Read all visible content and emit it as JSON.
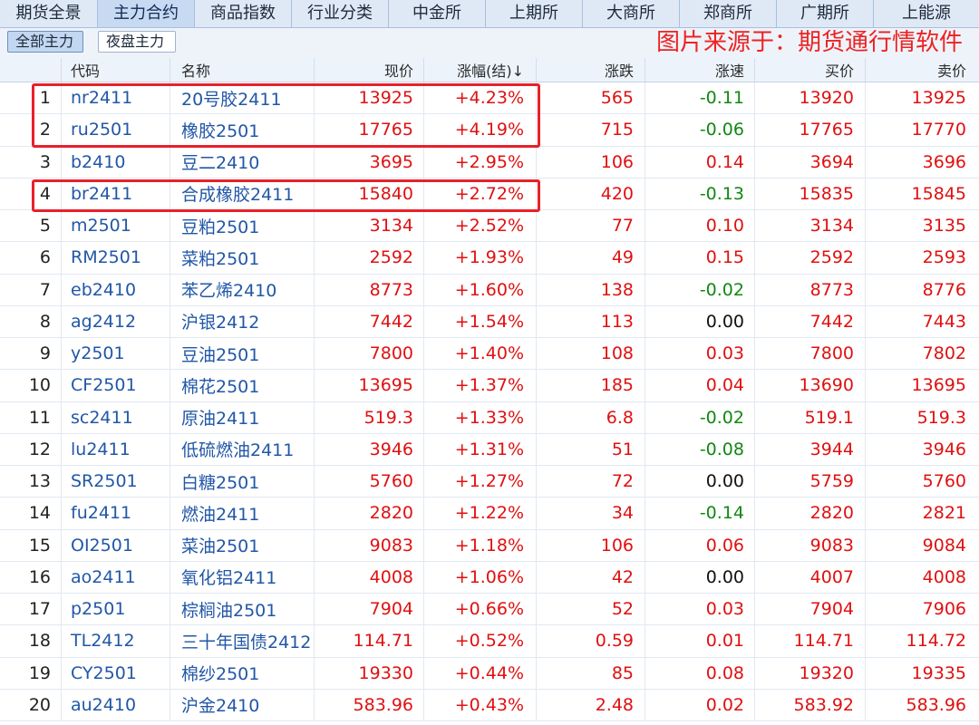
{
  "tabs": [
    {
      "label": "期货全景",
      "active": false
    },
    {
      "label": "主力合约",
      "active": true
    },
    {
      "label": "商品指数",
      "active": false
    },
    {
      "label": "行业分类",
      "active": false
    },
    {
      "label": "中金所",
      "active": false
    },
    {
      "label": "上期所",
      "active": false
    },
    {
      "label": "大商所",
      "active": false
    },
    {
      "label": "郑商所",
      "active": false
    },
    {
      "label": "广期所",
      "active": false
    },
    {
      "label": "上能源",
      "active": false
    }
  ],
  "subbar": {
    "all_main": "全部主力",
    "night_main": "夜盘主力",
    "watermark": "图片来源于：期货通行情软件"
  },
  "table": {
    "columns": [
      "",
      "代码",
      "名称",
      "现价",
      "涨幅(结)↓",
      "涨跌",
      "涨速",
      "买价",
      "卖价"
    ],
    "rows": [
      {
        "idx": "1",
        "code": "nr2411",
        "name": "20号胶2411",
        "price": "13925",
        "pct": "+4.23%",
        "chg": "565",
        "speed": "-0.11",
        "bid": "13920",
        "ask": "13925"
      },
      {
        "idx": "2",
        "code": "ru2501",
        "name": "橡胶2501",
        "price": "17765",
        "pct": "+4.19%",
        "chg": "715",
        "speed": "-0.06",
        "bid": "17765",
        "ask": "17770"
      },
      {
        "idx": "3",
        "code": "b2410",
        "name": "豆二2410",
        "price": "3695",
        "pct": "+2.95%",
        "chg": "106",
        "speed": "0.14",
        "bid": "3694",
        "ask": "3696"
      },
      {
        "idx": "4",
        "code": "br2411",
        "name": "合成橡胶2411",
        "price": "15840",
        "pct": "+2.72%",
        "chg": "420",
        "speed": "-0.13",
        "bid": "15835",
        "ask": "15845"
      },
      {
        "idx": "5",
        "code": "m2501",
        "name": "豆粕2501",
        "price": "3134",
        "pct": "+2.52%",
        "chg": "77",
        "speed": "0.10",
        "bid": "3134",
        "ask": "3135"
      },
      {
        "idx": "6",
        "code": "RM2501",
        "name": "菜粕2501",
        "price": "2592",
        "pct": "+1.93%",
        "chg": "49",
        "speed": "0.15",
        "bid": "2592",
        "ask": "2593"
      },
      {
        "idx": "7",
        "code": "eb2410",
        "name": "苯乙烯2410",
        "price": "8773",
        "pct": "+1.60%",
        "chg": "138",
        "speed": "-0.02",
        "bid": "8773",
        "ask": "8776"
      },
      {
        "idx": "8",
        "code": "ag2412",
        "name": "沪银2412",
        "price": "7442",
        "pct": "+1.54%",
        "chg": "113",
        "speed": "0.00",
        "bid": "7442",
        "ask": "7443"
      },
      {
        "idx": "9",
        "code": "y2501",
        "name": "豆油2501",
        "price": "7800",
        "pct": "+1.40%",
        "chg": "108",
        "speed": "0.03",
        "bid": "7800",
        "ask": "7802"
      },
      {
        "idx": "10",
        "code": "CF2501",
        "name": "棉花2501",
        "price": "13695",
        "pct": "+1.37%",
        "chg": "185",
        "speed": "0.04",
        "bid": "13690",
        "ask": "13695"
      },
      {
        "idx": "11",
        "code": "sc2411",
        "name": "原油2411",
        "price": "519.3",
        "pct": "+1.33%",
        "chg": "6.8",
        "speed": "-0.02",
        "bid": "519.1",
        "ask": "519.3"
      },
      {
        "idx": "12",
        "code": "lu2411",
        "name": "低硫燃油2411",
        "price": "3946",
        "pct": "+1.31%",
        "chg": "51",
        "speed": "-0.08",
        "bid": "3944",
        "ask": "3946"
      },
      {
        "idx": "13",
        "code": "SR2501",
        "name": "白糖2501",
        "price": "5760",
        "pct": "+1.27%",
        "chg": "72",
        "speed": "0.00",
        "bid": "5759",
        "ask": "5760"
      },
      {
        "idx": "14",
        "code": "fu2411",
        "name": "燃油2411",
        "price": "2820",
        "pct": "+1.22%",
        "chg": "34",
        "speed": "-0.14",
        "bid": "2820",
        "ask": "2821"
      },
      {
        "idx": "15",
        "code": "OI2501",
        "name": "菜油2501",
        "price": "9083",
        "pct": "+1.18%",
        "chg": "106",
        "speed": "0.06",
        "bid": "9083",
        "ask": "9084"
      },
      {
        "idx": "16",
        "code": "ao2411",
        "name": "氧化铝2411",
        "price": "4008",
        "pct": "+1.06%",
        "chg": "42",
        "speed": "0.00",
        "bid": "4007",
        "ask": "4008"
      },
      {
        "idx": "17",
        "code": "p2501",
        "name": "棕榈油2501",
        "price": "7904",
        "pct": "+0.66%",
        "chg": "52",
        "speed": "0.03",
        "bid": "7904",
        "ask": "7906"
      },
      {
        "idx": "18",
        "code": "TL2412",
        "name": "三十年国债2412",
        "price": "114.71",
        "pct": "+0.52%",
        "chg": "0.59",
        "speed": "0.01",
        "bid": "114.71",
        "ask": "114.72"
      },
      {
        "idx": "19",
        "code": "CY2501",
        "name": "棉纱2501",
        "price": "19330",
        "pct": "+0.44%",
        "chg": "85",
        "speed": "0.08",
        "bid": "19320",
        "ask": "19335"
      },
      {
        "idx": "20",
        "code": "au2410",
        "name": "沪金2410",
        "price": "583.96",
        "pct": "+0.43%",
        "chg": "2.48",
        "speed": "0.02",
        "bid": "583.92",
        "ask": "583.96"
      }
    ]
  },
  "colors": {
    "up": "#e01010",
    "down": "#118811",
    "flat": "#111111",
    "code_blue": "#2157a6",
    "highlight": "#e8202a"
  }
}
